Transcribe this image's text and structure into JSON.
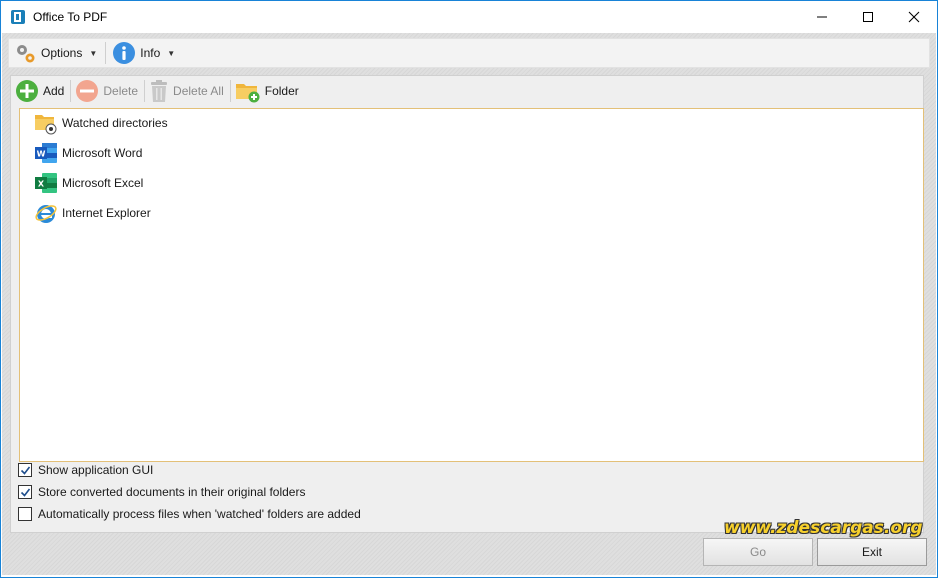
{
  "window": {
    "title": "Office To PDF"
  },
  "menubar": {
    "options_label": "Options",
    "info_label": "Info"
  },
  "toolbar": {
    "add_label": "Add",
    "delete_label": "Delete",
    "delete_all_label": "Delete All",
    "folder_label": "Folder"
  },
  "list": {
    "items": [
      {
        "label": "Watched directories",
        "icon": "watched-folder-icon"
      },
      {
        "label": "Microsoft Word",
        "icon": "word-icon"
      },
      {
        "label": "Microsoft Excel",
        "icon": "excel-icon"
      },
      {
        "label": "Internet Explorer",
        "icon": "ie-icon"
      }
    ]
  },
  "options": {
    "show_gui": {
      "label": "Show application GUI",
      "checked": true
    },
    "store_original": {
      "label": "Store converted documents in their original folders",
      "checked": true
    },
    "auto_process": {
      "label": "Automatically process files when 'watched' folders are added",
      "checked": false
    }
  },
  "buttons": {
    "go_label": "Go",
    "exit_label": "Exit"
  },
  "watermark": {
    "text": "www.zdescargas.org"
  },
  "colors": {
    "accent": "#1883d7",
    "list_border": "#e3c078",
    "watermark": "#f7d02c"
  }
}
